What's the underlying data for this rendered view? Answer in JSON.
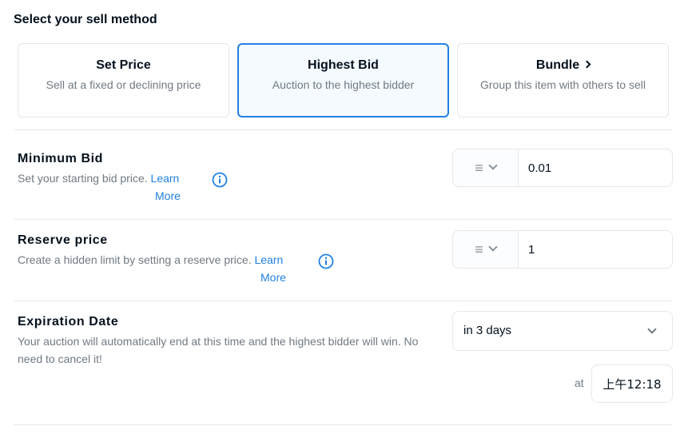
{
  "sell_method": {
    "heading": "Select your sell method",
    "options": [
      {
        "title": "Set Price",
        "subtitle": "Sell at a fixed or declining price",
        "selected": false
      },
      {
        "title": "Highest Bid",
        "subtitle": "Auction to the highest bidder",
        "selected": true
      },
      {
        "title": "Bundle",
        "subtitle": "Group this item with others to sell",
        "selected": false
      }
    ]
  },
  "minimum_bid": {
    "title": "Minimum Bid",
    "desc": "Set your starting bid price.",
    "link_line1": "Learn",
    "link_line2": "More",
    "token_icon": "≡",
    "value": "0.01"
  },
  "reserve_price": {
    "title": "Reserve price",
    "desc": "Create a hidden limit by setting a reserve price.",
    "link_line1": "Learn",
    "link_line2": "More",
    "token_icon": "≡",
    "value": "1"
  },
  "expiration": {
    "title": "Expiration Date",
    "desc_line1": "Your auction will automatically end at this time and the highest bidder will win. No",
    "desc_line2": "need to cancel it!",
    "selected_option": "in 3 days",
    "at_label": "at",
    "time_value": "上午12:18"
  },
  "colors": {
    "accent": "#2081e2",
    "border": "#e5e8eb",
    "text_primary": "#04111d",
    "text_secondary": "#707a83",
    "selected_bg": "#f5fafe"
  },
  "icons": {
    "info": "info-circle-icon",
    "token": "token-glyph-icon",
    "dropdown": "chevron-down-icon",
    "bundle_arrow": "chevron-right-icon"
  }
}
